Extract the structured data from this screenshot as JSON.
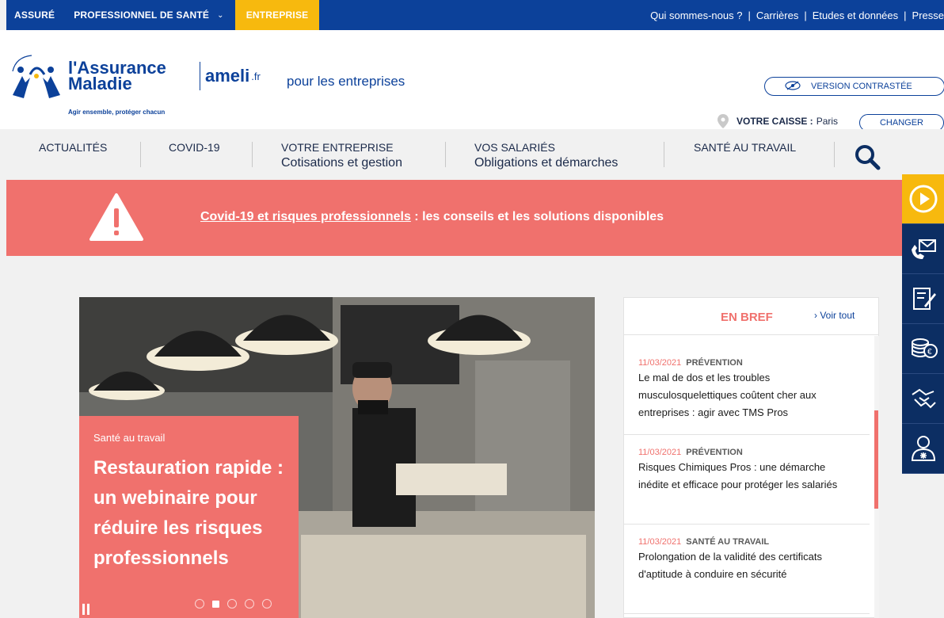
{
  "topbar": {
    "tabs": [
      {
        "label": "ASSURÉ"
      },
      {
        "label": "PROFESSIONNEL DE SANTÉ",
        "chevron": "⌄"
      },
      {
        "label": "ENTREPRISE",
        "active": true
      }
    ],
    "links": [
      "Qui sommes-nous ?",
      "Carrières",
      "Etudes et données",
      "Presse"
    ],
    "separator": "|"
  },
  "header": {
    "logo_line1": "l'Assurance",
    "logo_line2": "Maladie",
    "logo_tagline": "Agir ensemble, protéger chacun",
    "ameli": "ameli",
    "ameli_ext": ".fr",
    "subtitle": "pour les entreprises",
    "contrast_label": "VERSION CONTRASTÉE",
    "caisse_label": "VOTRE CAISSE :",
    "caisse_value": "Paris",
    "changer_label": "CHANGER"
  },
  "nav": {
    "items": [
      {
        "label": "ACTUALITÉS",
        "sub": ""
      },
      {
        "label": "COVID-19",
        "sub": ""
      },
      {
        "label": "VOTRE ENTREPRISE",
        "sub": "Cotisations et gestion"
      },
      {
        "label": "VOS SALARIÉS",
        "sub": "Obligations et démarches"
      },
      {
        "label": "SANTÉ AU TRAVAIL",
        "sub": ""
      }
    ],
    "search_icon": "search-icon"
  },
  "alert": {
    "link_text": "Covid-19 et risques professionnels",
    "rest_text": " : les conseils et les solutions disponibles",
    "icon": "warning-icon"
  },
  "hero": {
    "category": "Santé au travail",
    "title": "Restauration rapide : un webinaire pour réduire les risques professionnels",
    "slide_count": 5,
    "active_slide": 1
  },
  "bref": {
    "title": "EN BREF",
    "see_all": "› Voir tout",
    "items": [
      {
        "date": "11/03/2021",
        "category": "PRÉVENTION",
        "text": "Le mal de dos et les troubles musculosquelettiques coûtent cher aux entreprises : agir avec TMS Pros"
      },
      {
        "date": "11/03/2021",
        "category": "PRÉVENTION",
        "text": "Risques Chimiques Pros : une démarche inédite et efficace pour protéger les salariés"
      },
      {
        "date": "11/03/2021",
        "category": "SANTÉ AU TRAVAIL",
        "text": "Prolongation de la validité des certificats d'aptitude à conduire en sécurité"
      }
    ]
  },
  "side_tools": [
    "play-icon",
    "contact-phone-mail-icon",
    "form-edit-icon",
    "coins-euro-icon",
    "handshake-icon",
    "user-help-icon"
  ],
  "colors": {
    "navy": "#0c419a",
    "yellow": "#f7b90e",
    "coral": "#f0716d",
    "dark_navy": "#0c2e63"
  }
}
